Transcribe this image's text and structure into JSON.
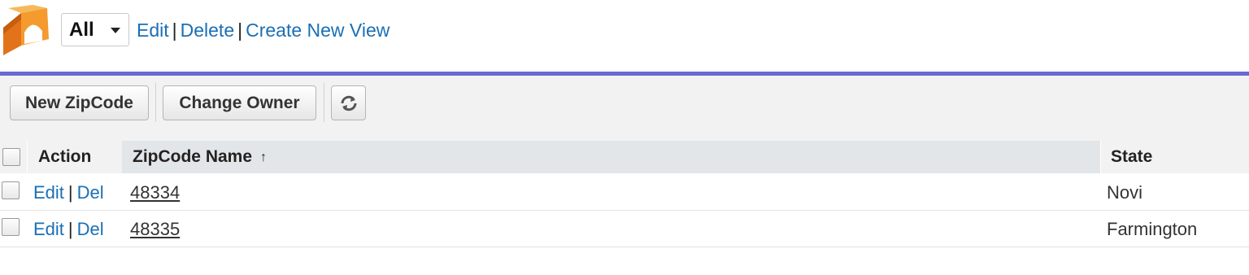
{
  "view": {
    "selected": "All",
    "links": [
      "Edit",
      "Delete",
      "Create New View"
    ]
  },
  "toolbar": {
    "new_label": "New ZipCode",
    "owner_label": "Change Owner",
    "refresh_icon": "refresh-icon"
  },
  "table": {
    "headers": {
      "action": "Action",
      "name": "ZipCode Name",
      "sort_arrow": "↑",
      "state": "State"
    },
    "rows": [
      {
        "edit": "Edit",
        "del": "Del",
        "name": "48334",
        "state": "Novi"
      },
      {
        "edit": "Edit",
        "del": "Del",
        "name": "48335",
        "state": "Farmington"
      }
    ]
  },
  "colors": {
    "link": "#1a6fb5",
    "accent_rule": "#6a6ad0",
    "logo_orange": "#f08a1c"
  }
}
